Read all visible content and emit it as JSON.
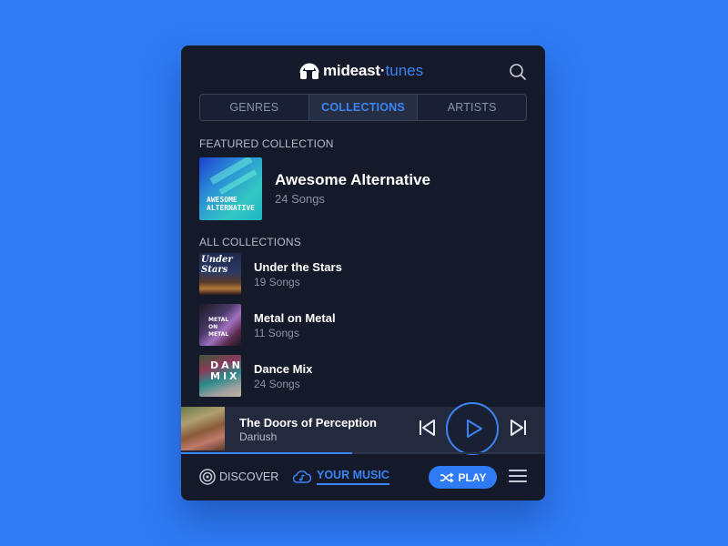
{
  "app": {
    "brand": {
      "main": "mideast",
      "separator": "·",
      "accent": "tunes"
    },
    "colors": {
      "accent": "#3a84f5",
      "background": "#2f7bf5",
      "panel": "#151a2b"
    }
  },
  "tabs": [
    {
      "label": "GENRES",
      "active": false
    },
    {
      "label": "COLLECTIONS",
      "active": true
    },
    {
      "label": "ARTISTS",
      "active": false
    }
  ],
  "featured": {
    "section_label": "FEATURED COLLECTION",
    "title": "Awesome Alternative",
    "subtitle": "24 Songs",
    "art_text": "AWESOME ALTERNATIVE"
  },
  "all_collections": {
    "section_label": "ALL COLLECTIONS",
    "items": [
      {
        "title": "Under the Stars",
        "subtitle": "19 Songs",
        "art_text": "Under Stars"
      },
      {
        "title": "Metal on Metal",
        "subtitle": "11 Songs",
        "art_text": "METAL ON METAL"
      },
      {
        "title": "Dance Mix",
        "subtitle": "24 Songs",
        "art_text": "DANCE MIX"
      }
    ]
  },
  "player": {
    "track_title": "The Doors of Perception",
    "artist": "Dariush",
    "progress_percent": 47
  },
  "bottom_nav": {
    "discover_label": "DISCOVER",
    "your_music_label": "YOUR MUSIC",
    "play_label": "PLAY"
  },
  "icons": {
    "logo": "headphones-logo-icon",
    "search": "search-icon",
    "prev": "skip-previous-icon",
    "play": "play-icon",
    "next": "skip-next-icon",
    "discover": "target-disc-icon",
    "your_music": "cloud-music-icon",
    "shuffle": "shuffle-icon",
    "menu": "hamburger-menu-icon"
  }
}
